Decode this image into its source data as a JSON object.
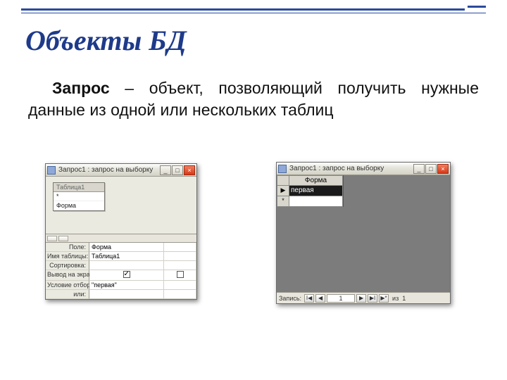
{
  "slide": {
    "title": "Объекты БД",
    "term": "Запрос",
    "definition": " – объект, позволяющий получить нужные данные из одной или нескольких таблиц"
  },
  "winLeft": {
    "title": "Запрос1 : запрос на выборку",
    "tableBox": {
      "header": "Таблица1",
      "rows": [
        "*",
        "Форма"
      ]
    },
    "gridLabels": {
      "field": "Поле:",
      "table": "Имя таблицы:",
      "sort": "Сортировка:",
      "show": "Вывод на экран:",
      "criteria": "Условие отбора:",
      "or": "или:"
    },
    "gridValues": {
      "field": "Форма",
      "table": "Таблица1",
      "sort": "",
      "showChecked": true,
      "criteria": "\"первая\"",
      "or": ""
    }
  },
  "winRight": {
    "title": "Запрос1 : запрос на выборку",
    "header": "Форма",
    "rows": [
      {
        "marker": "▶",
        "value": "первая",
        "selected": true
      },
      {
        "marker": "*",
        "value": "",
        "selected": false
      }
    ],
    "nav": {
      "label": "Запись:",
      "first": "I◀",
      "prev": "◀",
      "num": "1",
      "next": "▶",
      "last": "▶I",
      "new": "▶*",
      "of": "из",
      "total": "1"
    }
  },
  "winBtns": {
    "min": "_",
    "max": "□",
    "close": "×"
  }
}
